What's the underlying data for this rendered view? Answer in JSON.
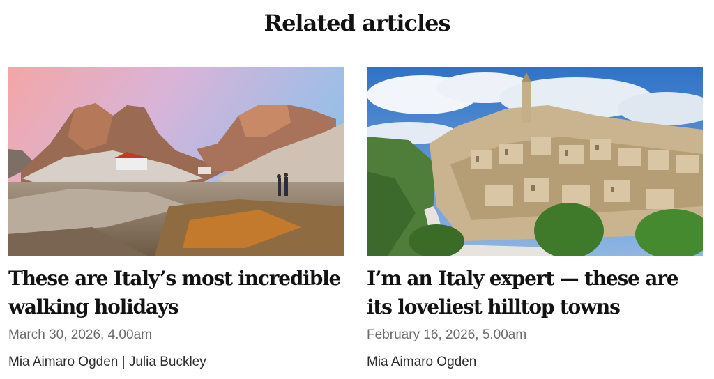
{
  "section": {
    "title": "Related articles"
  },
  "articles": [
    {
      "title": "These are Italy’s most incredible walking holidays",
      "date": "March 30, 2026, 4.00am",
      "authors": "Mia Aimaro Ogden | Julia Buckley",
      "image_subject": "mountain-hiking-photo"
    },
    {
      "title": "I’m an Italy expert — these are its loveliest hilltop towns",
      "date": "February 16, 2026, 5.00am",
      "authors": "Mia Aimaro Ogden",
      "image_subject": "hilltop-town-photo"
    }
  ],
  "colors": {
    "text": "#121212",
    "meta": "#6b6b6b",
    "divider": "#dcdcdc"
  }
}
